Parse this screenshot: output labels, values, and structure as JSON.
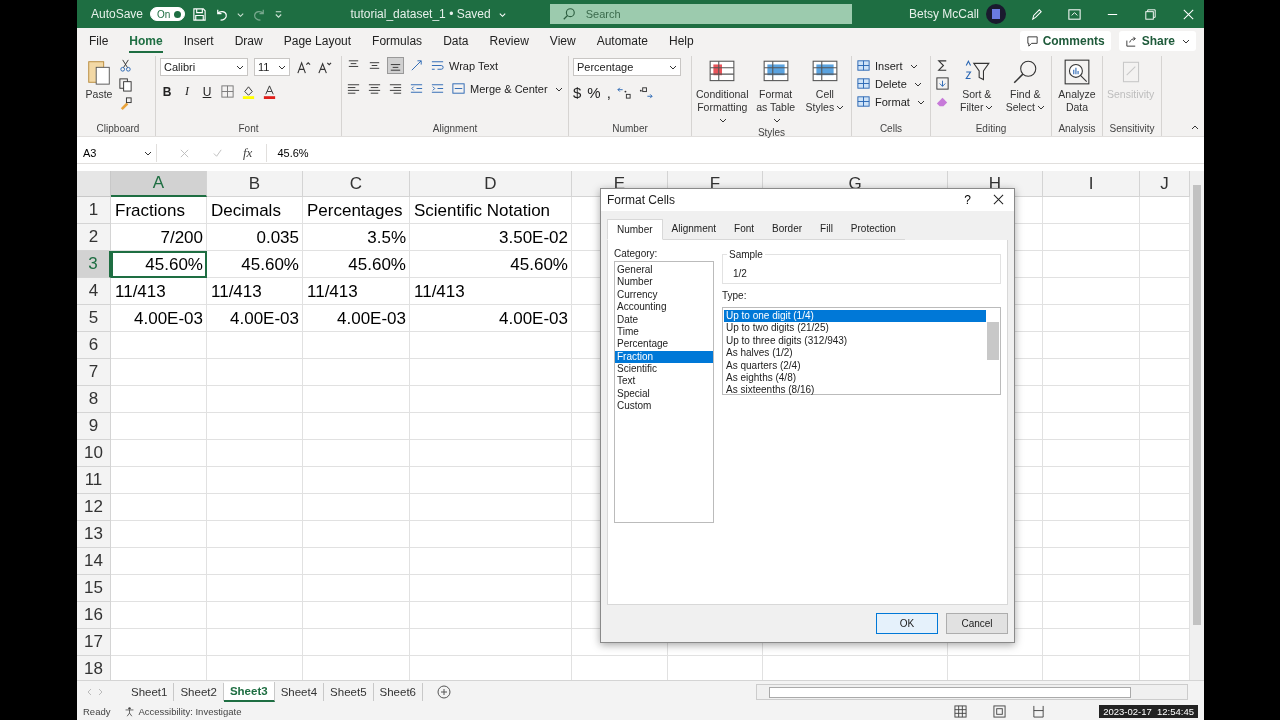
{
  "title_bar": {
    "autosave": {
      "label": "AutoSave",
      "state_text": "On",
      "on": true
    },
    "document": "tutorial_dataset_1 • Saved",
    "search": {
      "placeholder": "Search"
    },
    "user": "Betsy McCall"
  },
  "menu": {
    "tabs": [
      {
        "label": "File",
        "selected": false
      },
      {
        "label": "Home",
        "selected": true
      },
      {
        "label": "Insert",
        "selected": false
      },
      {
        "label": "Draw",
        "selected": false
      },
      {
        "label": "Page Layout",
        "selected": false
      },
      {
        "label": "Formulas",
        "selected": false
      },
      {
        "label": "Data",
        "selected": false
      },
      {
        "label": "Review",
        "selected": false
      },
      {
        "label": "View",
        "selected": false
      },
      {
        "label": "Automate",
        "selected": false
      },
      {
        "label": "Help",
        "selected": false
      }
    ],
    "comments": "Comments",
    "share": "Share"
  },
  "ribbon": {
    "clipboard": {
      "label": "Clipboard",
      "paste": "Paste"
    },
    "font": {
      "label": "Font",
      "family": "Calibri",
      "size": "11",
      "styles": [
        "B",
        "I",
        "U"
      ]
    },
    "alignment": {
      "label": "Alignment",
      "vertical": [
        {
          "selected": false
        },
        {
          "selected": false
        },
        {
          "selected": true
        }
      ],
      "wrap": "Wrap Text",
      "merge": "Merge & Center"
    },
    "number": {
      "label": "Number",
      "format": "Percentage",
      "symbols": [
        "$",
        "%",
        ","
      ]
    },
    "styles": {
      "label": "Styles",
      "buttons": [
        "Conditional Formatting",
        "Format as Table",
        "Cell Styles"
      ]
    },
    "cells": {
      "label": "Cells",
      "buttons": [
        "Insert",
        "Delete",
        "Format"
      ]
    },
    "editing": {
      "label": "Editing",
      "buttons": [
        "Sort & Filter",
        "Find & Select"
      ]
    },
    "analysis": {
      "label": "Analysis",
      "button": "Analyze Data"
    },
    "sensitivity": {
      "label": "Sensitivity",
      "button": "Sensitivity",
      "disabled": true
    }
  },
  "formula_bar": {
    "name_box": "A3",
    "fx": "fx",
    "formula": "45.6%"
  },
  "sheet": {
    "columns": [
      {
        "label": "A",
        "selected": true
      },
      {
        "label": "B",
        "selected": false
      },
      {
        "label": "C",
        "selected": false
      },
      {
        "label": "D",
        "selected": false
      },
      {
        "label": "E",
        "selected": false
      },
      {
        "label": "F",
        "selected": false
      },
      {
        "label": "G",
        "selected": false
      },
      {
        "label": "H",
        "selected": false
      },
      {
        "label": "I",
        "selected": false
      },
      {
        "label": "J",
        "selected": false
      }
    ],
    "rows": [
      {
        "number": "1",
        "selected": false,
        "cells": [
          {
            "text": "Fractions",
            "kind": "text",
            "selected": false
          },
          {
            "text": "Decimals",
            "kind": "text",
            "selected": false
          },
          {
            "text": "Percentages",
            "kind": "text",
            "selected": false
          },
          {
            "text": "Scientific Notation",
            "kind": "text",
            "selected": false
          }
        ]
      },
      {
        "number": "2",
        "selected": false,
        "cells": [
          {
            "text": "7/200",
            "kind": "number",
            "selected": false
          },
          {
            "text": "0.035",
            "kind": "number",
            "selected": false
          },
          {
            "text": "3.5%",
            "kind": "number",
            "selected": false
          },
          {
            "text": "3.50E-02",
            "kind": "number",
            "selected": false
          }
        ]
      },
      {
        "number": "3",
        "selected": true,
        "cells": [
          {
            "text": "45.60%",
            "kind": "number",
            "selected": true
          },
          {
            "text": "45.60%",
            "kind": "number",
            "selected": false
          },
          {
            "text": "45.60%",
            "kind": "number",
            "selected": false
          },
          {
            "text": "45.60%",
            "kind": "number",
            "selected": false
          }
        ]
      },
      {
        "number": "4",
        "selected": false,
        "cells": [
          {
            "text": "11/413",
            "kind": "text",
            "selected": false
          },
          {
            "text": "11/413",
            "kind": "text",
            "selected": false
          },
          {
            "text": "11/413",
            "kind": "text",
            "selected": false
          },
          {
            "text": "11/413",
            "kind": "text",
            "selected": false
          }
        ]
      },
      {
        "number": "5",
        "selected": false,
        "cells": [
          {
            "text": "4.00E-03",
            "kind": "number",
            "selected": false
          },
          {
            "text": "4.00E-03",
            "kind": "number",
            "selected": false
          },
          {
            "text": "4.00E-03",
            "kind": "number",
            "selected": false
          },
          {
            "text": "4.00E-03",
            "kind": "number",
            "selected": false
          }
        ]
      },
      {
        "number": "6",
        "selected": false,
        "cells": []
      },
      {
        "number": "7",
        "selected": false,
        "cells": []
      },
      {
        "number": "8",
        "selected": false,
        "cells": []
      },
      {
        "number": "9",
        "selected": false,
        "cells": []
      },
      {
        "number": "10",
        "selected": false,
        "cells": []
      },
      {
        "number": "11",
        "selected": false,
        "cells": []
      },
      {
        "number": "12",
        "selected": false,
        "cells": []
      },
      {
        "number": "13",
        "selected": false,
        "cells": []
      },
      {
        "number": "14",
        "selected": false,
        "cells": []
      },
      {
        "number": "15",
        "selected": false,
        "cells": []
      },
      {
        "number": "16",
        "selected": false,
        "cells": []
      },
      {
        "number": "17",
        "selected": false,
        "cells": []
      },
      {
        "number": "18",
        "selected": false,
        "cells": []
      }
    ]
  },
  "dialog": {
    "title": "Format Cells",
    "help": "?",
    "tabs": [
      {
        "label": "Number",
        "selected": true
      },
      {
        "label": "Alignment",
        "selected": false
      },
      {
        "label": "Font",
        "selected": false
      },
      {
        "label": "Border",
        "selected": false
      },
      {
        "label": "Fill",
        "selected": false
      },
      {
        "label": "Protection",
        "selected": false
      }
    ],
    "category_label": "Category:",
    "categories": [
      {
        "label": "General",
        "selected": false
      },
      {
        "label": "Number",
        "selected": false
      },
      {
        "label": "Currency",
        "selected": false
      },
      {
        "label": "Accounting",
        "selected": false
      },
      {
        "label": "Date",
        "selected": false
      },
      {
        "label": "Time",
        "selected": false
      },
      {
        "label": "Percentage",
        "selected": false
      },
      {
        "label": "Fraction",
        "selected": true
      },
      {
        "label": "Scientific",
        "selected": false
      },
      {
        "label": "Text",
        "selected": false
      },
      {
        "label": "Special",
        "selected": false
      },
      {
        "label": "Custom",
        "selected": false
      }
    ],
    "sample_label": "Sample",
    "sample": "1/2",
    "type_label": "Type:",
    "types": [
      {
        "label": "Up to one digit (1/4)",
        "selected": true
      },
      {
        "label": "Up to two digits (21/25)",
        "selected": false
      },
      {
        "label": "Up to three digits (312/943)",
        "selected": false
      },
      {
        "label": "As halves (1/2)",
        "selected": false
      },
      {
        "label": "As quarters (2/4)",
        "selected": false
      },
      {
        "label": "As eighths (4/8)",
        "selected": false
      },
      {
        "label": "As sixteenths (8/16)",
        "selected": false
      }
    ],
    "buttons": [
      {
        "label": "OK",
        "default": true
      },
      {
        "label": "Cancel",
        "default": false
      }
    ]
  },
  "sheet_tabs": [
    {
      "label": "Sheet1",
      "selected": false
    },
    {
      "label": "Sheet2",
      "selected": false
    },
    {
      "label": "Sheet3",
      "selected": true
    },
    {
      "label": "Sheet4",
      "selected": false
    },
    {
      "label": "Sheet5",
      "selected": false
    },
    {
      "label": "Sheet6",
      "selected": false
    }
  ],
  "status_bar": {
    "status": "Ready",
    "accessibility": "Accessibility: Investigate",
    "timestamp": "2023-02-17  12:54:45"
  }
}
